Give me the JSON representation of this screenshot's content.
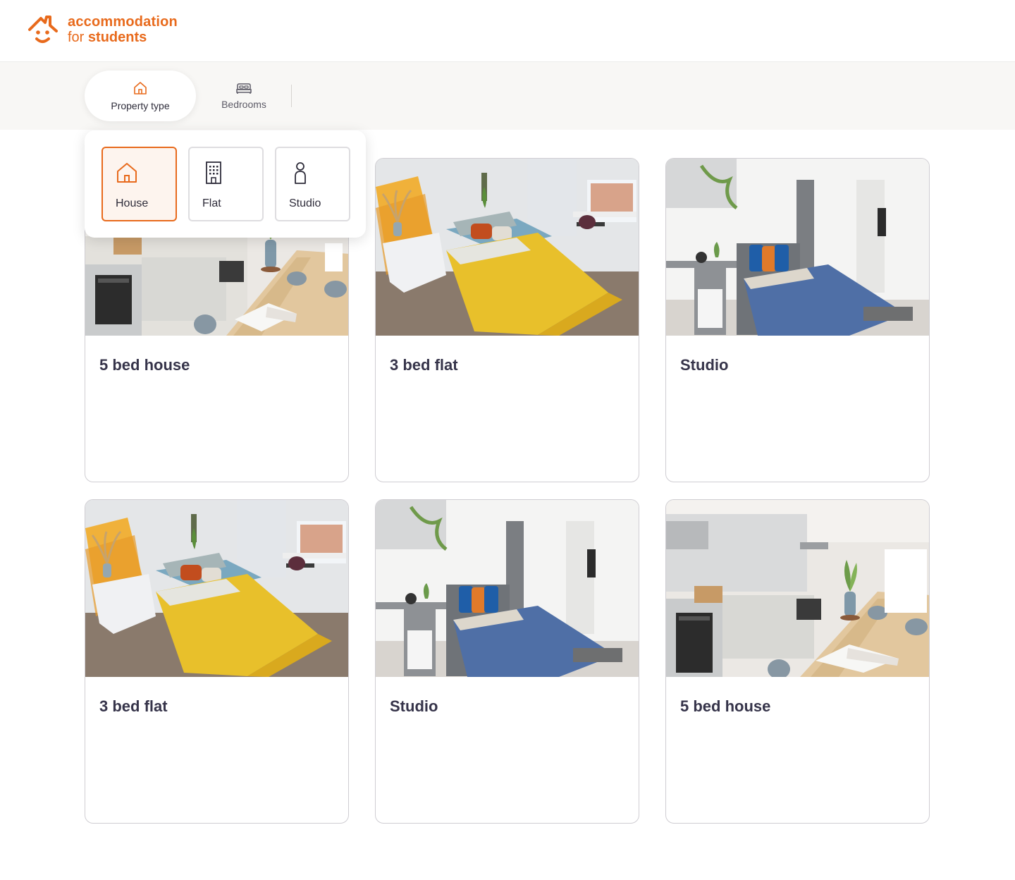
{
  "brand": {
    "line1": "accommodation",
    "line2_prefix": "for ",
    "line2_bold": "students",
    "color": "#e86a1c"
  },
  "filters": {
    "property_type_label": "Property type",
    "bedrooms_label": "Bedrooms"
  },
  "property_type_options": [
    {
      "label": "House",
      "icon": "house-icon",
      "selected": true
    },
    {
      "label": "Flat",
      "icon": "building-icon",
      "selected": false
    },
    {
      "label": "Studio",
      "icon": "person-icon",
      "selected": false
    }
  ],
  "listings": [
    {
      "title": "5 bed house",
      "image": "kitchen-photo"
    },
    {
      "title": "3 bed flat",
      "image": "bedroom-yellow-photo"
    },
    {
      "title": "Studio",
      "image": "studio-blue-photo"
    },
    {
      "title": "3 bed flat",
      "image": "bedroom-yellow-photo"
    },
    {
      "title": "Studio",
      "image": "studio-blue-photo"
    },
    {
      "title": "5 bed house",
      "image": "kitchen-photo"
    }
  ]
}
